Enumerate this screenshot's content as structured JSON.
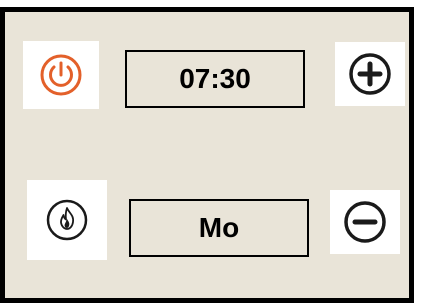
{
  "controls": {
    "time_display": "07:30",
    "day_display": "Mo",
    "icons": {
      "power": "power-icon",
      "flame": "flame-icon",
      "increase": "plus-circle-icon",
      "decrease": "minus-circle-icon"
    }
  },
  "colors": {
    "panel_background": "#e9e4d8",
    "border": "#000000",
    "power_icon": "#e3602a",
    "icon_dark": "#1a1a1a"
  }
}
